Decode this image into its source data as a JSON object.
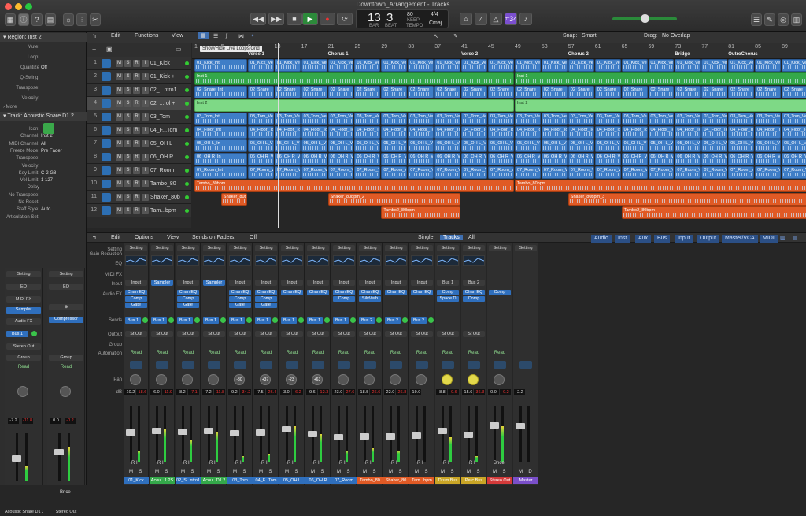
{
  "window": {
    "title": "Downtown_Arrangement - Tracks"
  },
  "lcd": {
    "bar": "13",
    "beat": "3",
    "bar_label": "BAR",
    "beat_label": "BEAT",
    "tempo": "80",
    "tempo_label": "KEEP",
    "tempo_sub": "TEMPO",
    "sig": "4/4",
    "key": "Cmaj"
  },
  "toolbar": {
    "count_badge": "⌗34"
  },
  "inspector": {
    "region_header": "▾ Region: Inst 2",
    "region_rows": [
      {
        "k": "Mute:",
        "v": ""
      },
      {
        "k": "Loop:",
        "v": ""
      },
      {
        "k": "Quantize",
        "v": "Off"
      },
      {
        "k": "Q-Swing:",
        "v": ""
      },
      {
        "k": "Transpose:",
        "v": ""
      },
      {
        "k": "Velocity:",
        "v": ""
      }
    ],
    "more": "› More",
    "track_header": "▾ Track: Acoustic Snare D1 2",
    "track_rows": [
      {
        "k": "Icon:",
        "v": ""
      },
      {
        "k": "Channel:",
        "v": "Inst 2"
      },
      {
        "k": "MIDI Channel:",
        "v": "All"
      },
      {
        "k": "Freeze Mode:",
        "v": "Pre Fader"
      },
      {
        "k": "Transpose:",
        "v": ""
      },
      {
        "k": "Velocity:",
        "v": ""
      },
      {
        "k": "Key Limit:",
        "v": "C-2  G8"
      },
      {
        "k": "Vel Limit:",
        "v": "1  127"
      },
      {
        "k": "Delay",
        "v": ""
      },
      {
        "k": "No Transpose:",
        "v": ""
      },
      {
        "k": "No Reset:",
        "v": ""
      },
      {
        "k": "Staff Style:",
        "v": "Auto"
      },
      {
        "k": "Articulation Set:",
        "v": ""
      }
    ],
    "strips": [
      {
        "setting": "Setting",
        "eq": "EQ",
        "midifx": "MIDI FX",
        "inst": "Sampler",
        "audiofx": "Audio FX",
        "send": "Bus 1",
        "out": "Stereo Out",
        "group": "Group",
        "read": "Read",
        "db1": "-7.2",
        "db2": "-11.8",
        "name": "Acoustic Snare D1 2"
      },
      {
        "setting": "Setting",
        "eq": "EQ",
        "midifx": "",
        "inst": "Compressor",
        "audiofx": "",
        "send": "",
        "out": "",
        "group": "Group",
        "read": "Read",
        "db1": "0.0",
        "db2": "-0.2",
        "name": "Stereo Out",
        "bnce": "Bnce"
      }
    ]
  },
  "tracks_menu": {
    "edit": "Edit",
    "functions": "Functions",
    "view": "View",
    "tooltip": "Show/Hide Live Loops Grid",
    "snap_label": "Snap:",
    "snap_value": "Smart",
    "drag_label": "Drag:",
    "drag_value": "No Overlap"
  },
  "ruler": {
    "bars": [
      "1",
      "5",
      "9",
      "13",
      "17",
      "21",
      "25",
      "29",
      "33",
      "37",
      "41",
      "45",
      "49",
      "53",
      "57",
      "61",
      "65",
      "69",
      "73",
      "77",
      "81",
      "85",
      "89"
    ],
    "sections": [
      {
        "label": "Verse 1",
        "bar": 9
      },
      {
        "label": "Chorus 1",
        "bar": 21
      },
      {
        "label": "Verse 2",
        "bar": 41
      },
      {
        "label": "Chorus 2",
        "bar": 57
      },
      {
        "label": "Bridge",
        "bar": 73
      },
      {
        "label": "OutroChorus",
        "bar": 81
      }
    ]
  },
  "tracks": [
    {
      "num": "1",
      "name": "01_Kick",
      "color": "blue"
    },
    {
      "num": "2",
      "name": "01_Kick +",
      "color": "green"
    },
    {
      "num": "3",
      "name": "02_...ntro1",
      "color": "blue"
    },
    {
      "num": "4",
      "name": "02_...rol +",
      "color": "lgreen",
      "selected": true
    },
    {
      "num": "5",
      "name": "03_Tom",
      "color": "blue"
    },
    {
      "num": "6",
      "name": "04_F...Tom",
      "color": "blue"
    },
    {
      "num": "7",
      "name": "05_OH L",
      "color": "blue"
    },
    {
      "num": "8",
      "name": "06_OH R",
      "color": "blue"
    },
    {
      "num": "9",
      "name": "07_Room",
      "color": "blue"
    },
    {
      "num": "10",
      "name": "Tambo_80",
      "color": "orange"
    },
    {
      "num": "11",
      "name": "Shaker_80b",
      "color": "orange"
    },
    {
      "num": "12",
      "name": "Tam...bpm",
      "color": "orange"
    }
  ],
  "region_labels": {
    "kick": "01_Kick_Ve",
    "kick_int": "01_Kick_Int",
    "inst1": "Inst 1",
    "snare": "02_Snare_",
    "snare_int": "02_Snare_Int",
    "inst2": "Inst 2",
    "tom": "03_Tom_Ve",
    "tom_int": "03_Tom_Int",
    "floor": "04_Floor_To",
    "floor_int": "04_Floor_Int",
    "ohl": "05_OH L_V",
    "ohl_int": "05_OH L_In",
    "ohr": "06_OH R_V",
    "ohr_int": "06_OH R_In",
    "room": "07_Room_V",
    "room_int": "07_Room_Int",
    "tambo": "Tambo_80bpm",
    "shaker_a": "Shaker_80b",
    "shaker_b": "Shaker_80bpm_2",
    "shaker_c": "Shaker_80bpm_3",
    "tambo2": "Tambo2_80bpm"
  },
  "mixer_menu": {
    "edit": "Edit",
    "options": "Options",
    "view": "View",
    "sends_label": "Sends on Faders:",
    "sends_value": "Off",
    "single": "Single",
    "tracks": "Tracks",
    "all": "All",
    "filters": [
      "Audio",
      "Inst",
      "Aux",
      "Bus",
      "Input",
      "Output",
      "Master/VCA",
      "MIDI"
    ]
  },
  "mixer_rows": {
    "setting": "Setting",
    "gain": "Gain Reduction",
    "eq": "EQ",
    "midifx": "MIDI FX",
    "input": "Input",
    "audiofx": "Audio FX",
    "sends": "Sends",
    "output": "Output",
    "group": "Group",
    "automation": "Automation",
    "pan": "Pan",
    "db": "dB"
  },
  "strips": [
    {
      "name": "01_Kick",
      "color": "#2f6fbd",
      "input": "Input",
      "fx": [
        "Chan EQ",
        "Comp",
        "Gate"
      ],
      "send": "Bus 1",
      "out": "St Out",
      "read": "Read",
      "pan": "",
      "db1": "-10.2",
      "db2": "-18.6",
      "fad": 60,
      "met": 20
    },
    {
      "name": "Acou...1 2S",
      "color": "#34a84a",
      "input": "Sampler",
      "fx": [],
      "send": "Bus 1",
      "out": "St Out",
      "read": "Read",
      "pan": "",
      "db1": "-6.0",
      "db2": "-11.9",
      "fad": 55,
      "met": 60
    },
    {
      "name": "02_S...ntro1",
      "color": "#2f6fbd",
      "input": "Input",
      "fx": [
        "Chan EQ",
        "Comp",
        "Gate"
      ],
      "send": "Bus 1",
      "out": "St Out",
      "read": "Read",
      "pan": "",
      "db1": "-8.2",
      "db2": "-7.1",
      "fad": 58,
      "met": 40
    },
    {
      "name": "Acou...D1 2",
      "color": "#34a84a",
      "input": "Sampler",
      "fx": [],
      "send": "Bus 1",
      "out": "St Out",
      "read": "Read",
      "pan": "",
      "db1": "-7.2",
      "db2": "-11.8",
      "fad": 56,
      "met": 55
    },
    {
      "name": "03_Tom",
      "color": "#2f6fbd",
      "input": "Input",
      "fx": [
        "Chan EQ",
        "Comp",
        "Gate"
      ],
      "send": "Bus 1",
      "out": "St Out",
      "read": "Read",
      "pan": "-30",
      "db1": "-9.2",
      "db2": "-34.2",
      "fad": 62,
      "met": 10
    },
    {
      "name": "04_F...Tom",
      "color": "#2f6fbd",
      "input": "Input",
      "fx": [
        "Chan EQ",
        "Comp",
        "Gate"
      ],
      "send": "Bus 1",
      "out": "St Out",
      "read": "Read",
      "pan": "+37",
      "db1": "-7.5",
      "db2": "-26.4",
      "fad": 60,
      "met": 15
    },
    {
      "name": "05_OH L",
      "color": "#2f6fbd",
      "input": "Input",
      "fx": [
        "Chan EQ"
      ],
      "send": "Bus 1",
      "out": "St Out",
      "read": "Read",
      "pan": "-23",
      "db1": "-3.0",
      "db2": "-6.2",
      "fad": 50,
      "met": 65
    },
    {
      "name": "06_OH R",
      "color": "#2f6fbd",
      "input": "Input",
      "fx": [
        "Chan EQ"
      ],
      "send": "Bus 1",
      "out": "St Out",
      "read": "Read",
      "pan": "+63",
      "db1": "-9.6",
      "db2": "-12.3",
      "fad": 64,
      "met": 50
    },
    {
      "name": "07_Room",
      "color": "#2f6fbd",
      "input": "Input",
      "fx": [
        "Chan EQ",
        "Comp"
      ],
      "send": "Bus 1",
      "out": "St Out",
      "read": "Read",
      "pan": "",
      "db1": "-23.0",
      "db2": "-27.6",
      "fad": 72,
      "met": 20
    },
    {
      "name": "Tambo_80",
      "color": "#e05a25",
      "input": "Input",
      "fx": [
        "Chan EQ",
        "SilvVerb"
      ],
      "send": "Bus 2",
      "out": "St Out",
      "read": "Read",
      "pan": "",
      "db1": "-18.5",
      "db2": "-26.6",
      "fad": 70,
      "met": 25
    },
    {
      "name": "Shaker_80",
      "color": "#e05a25",
      "input": "Input",
      "fx": [
        "Chan EQ"
      ],
      "send": "Bus 2",
      "out": "St Out",
      "read": "Read",
      "pan": "",
      "db1": "-22.0",
      "db2": "-26.8",
      "fad": 70,
      "met": 20
    },
    {
      "name": "Tam...bpm",
      "color": "#e05a25",
      "input": "Input",
      "fx": [
        "Chan EQ"
      ],
      "send": "Bus 2",
      "out": "St Out",
      "read": "Read",
      "pan": "",
      "db1": "-19.0",
      "db2": "",
      "fad": 68,
      "met": 0
    },
    {
      "name": "Drum Bus",
      "color": "#c9a526",
      "input": "Bus 1",
      "fx": [
        "Comp",
        "Space D"
      ],
      "send": "",
      "out": "St Out",
      "read": "Read",
      "pan": "y",
      "db1": "-8.8",
      "db2": "-9.6",
      "fad": 55,
      "met": 45
    },
    {
      "name": "Perc Bus",
      "color": "#c9a526",
      "input": "Bus 2",
      "fx": [
        "Chan EQ",
        "Comp"
      ],
      "send": "",
      "out": "St Out",
      "read": "Read",
      "pan": "y",
      "db1": "-15.6",
      "db2": "-36.3",
      "fad": 66,
      "met": 10
    },
    {
      "name": "Stereo Out",
      "color": "#d43a3a",
      "input": "",
      "fx": [
        "Comp"
      ],
      "send": "",
      "out": "",
      "read": "Read",
      "pan": "",
      "db1": "0.0",
      "db2": "-0.2",
      "fad": 40,
      "met": 65,
      "bnce": "Bnce"
    },
    {
      "name": "Master",
      "color": "#7a4fc9",
      "input": "",
      "fx": [],
      "send": "",
      "out": "",
      "read": "",
      "pan": "",
      "db1": "-2.2",
      "db2": "",
      "fad": 42,
      "met": 0,
      "md": true
    }
  ]
}
